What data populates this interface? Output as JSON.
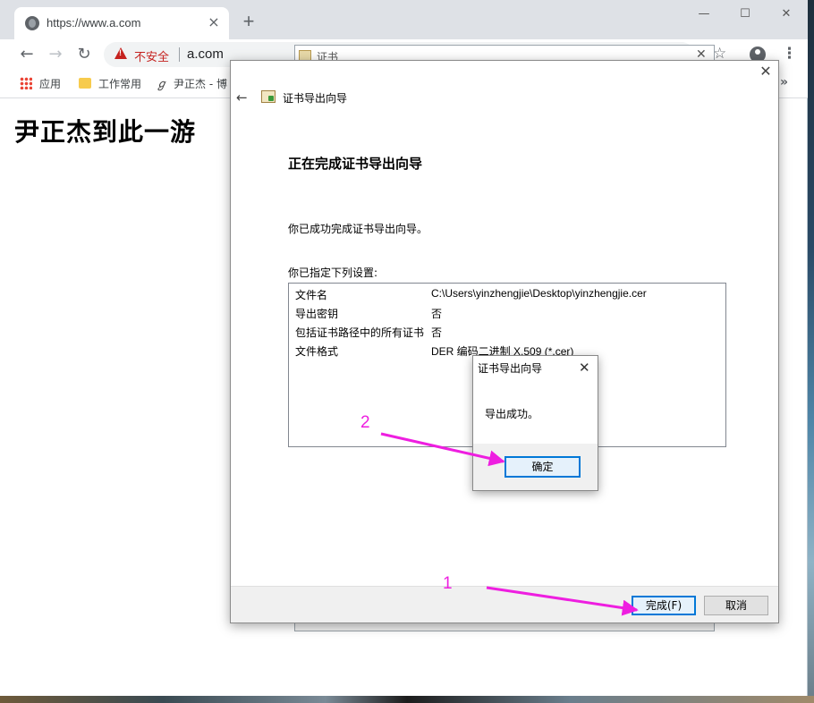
{
  "browser": {
    "tab": {
      "title": "https://www.a.com",
      "close": "×"
    },
    "new_tab": "+",
    "window_controls": {
      "minimize": "—",
      "maximize": "☐",
      "close": "✕"
    },
    "nav": {
      "back": "←",
      "forward": "→",
      "reload": "↻"
    },
    "omnibox": {
      "security_label": "不安全",
      "url": "a.com"
    },
    "bookmarks": [
      {
        "label": "应用",
        "icon": "apps-grid-icon"
      },
      {
        "label": "工作常用",
        "icon": "folder-icon"
      },
      {
        "label": "尹正杰 - 博",
        "icon": "web-icon"
      }
    ],
    "bookmarks_overflow": "»"
  },
  "page": {
    "heading": "尹正杰到此一游"
  },
  "background_window": {
    "title": "证书",
    "close": "✕"
  },
  "wizard": {
    "title": "证书导出向导",
    "heading": "正在完成证书导出向导",
    "line1": "你已成功完成证书导出向导。",
    "line2": "你已指定下列设置:",
    "settings": [
      {
        "key": "文件名",
        "value": "C:\\Users\\yinzhengjie\\Desktop\\yinzhengjie.cer"
      },
      {
        "key": "导出密钥",
        "value": "否"
      },
      {
        "key": "包括证书路径中的所有证书",
        "value": "否"
      },
      {
        "key": "文件格式",
        "value": "DER 编码二进制 X.509 (*.cer)"
      }
    ],
    "finish_label": "完成(F)",
    "cancel_label": "取消"
  },
  "message_box": {
    "title": "证书导出向导",
    "text": "导出成功。",
    "ok_label": "确定"
  },
  "annotations": {
    "step1": "1",
    "step2": "2",
    "color": "#ee1ee0"
  }
}
